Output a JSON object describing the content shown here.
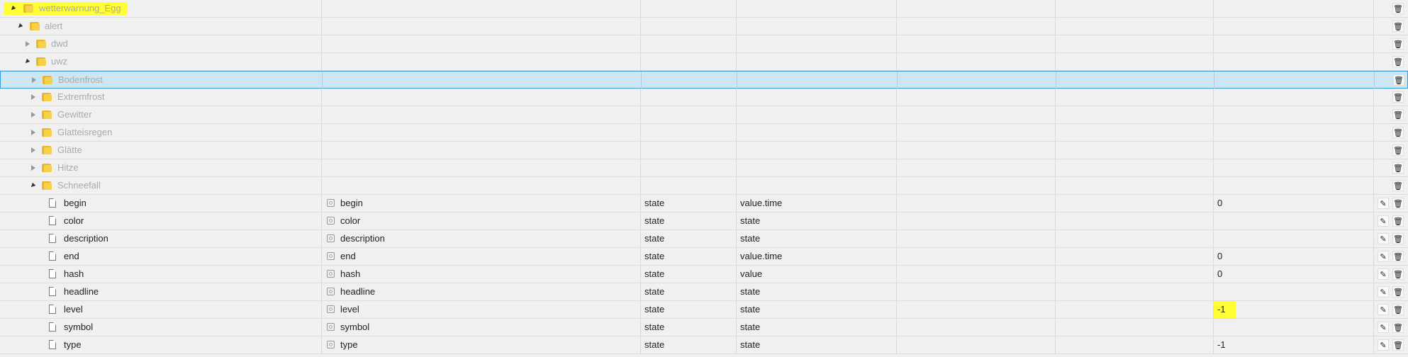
{
  "tree": {
    "root": {
      "label": "wetterwarnung_Egg"
    },
    "folders": [
      {
        "label": "alert"
      },
      {
        "label": "dwd"
      },
      {
        "label": "uwz"
      },
      {
        "label": "Bodenfrost"
      },
      {
        "label": "Extremfrost"
      },
      {
        "label": "Gewitter"
      },
      {
        "label": "Glatteisregen"
      },
      {
        "label": "Glätte"
      },
      {
        "label": "Hitze"
      },
      {
        "label": "Schneefall"
      }
    ],
    "states": [
      {
        "id": "begin",
        "name": "begin",
        "type": "state",
        "role": "value.time",
        "value": "0"
      },
      {
        "id": "color",
        "name": "color",
        "type": "state",
        "role": "state",
        "value": ""
      },
      {
        "id": "description",
        "name": "description",
        "type": "state",
        "role": "state",
        "value": ""
      },
      {
        "id": "end",
        "name": "end",
        "type": "state",
        "role": "value.time",
        "value": "0"
      },
      {
        "id": "hash",
        "name": "hash",
        "type": "state",
        "role": "value",
        "value": "0"
      },
      {
        "id": "headline",
        "name": "headline",
        "type": "state",
        "role": "state",
        "value": ""
      },
      {
        "id": "level",
        "name": "level",
        "type": "state",
        "role": "state",
        "value": "-1"
      },
      {
        "id": "symbol",
        "name": "symbol",
        "type": "state",
        "role": "state",
        "value": ""
      },
      {
        "id": "type",
        "name": "type",
        "type": "state",
        "role": "state",
        "value": "-1"
      }
    ]
  },
  "icons": {
    "delete": "trash-icon",
    "edit": "pencil-icon"
  },
  "colors": {
    "highlight": "#ffff33",
    "selected_row": "#cce6f4",
    "selected_border": "#3b9ad9",
    "folder": "#f5d04a"
  }
}
